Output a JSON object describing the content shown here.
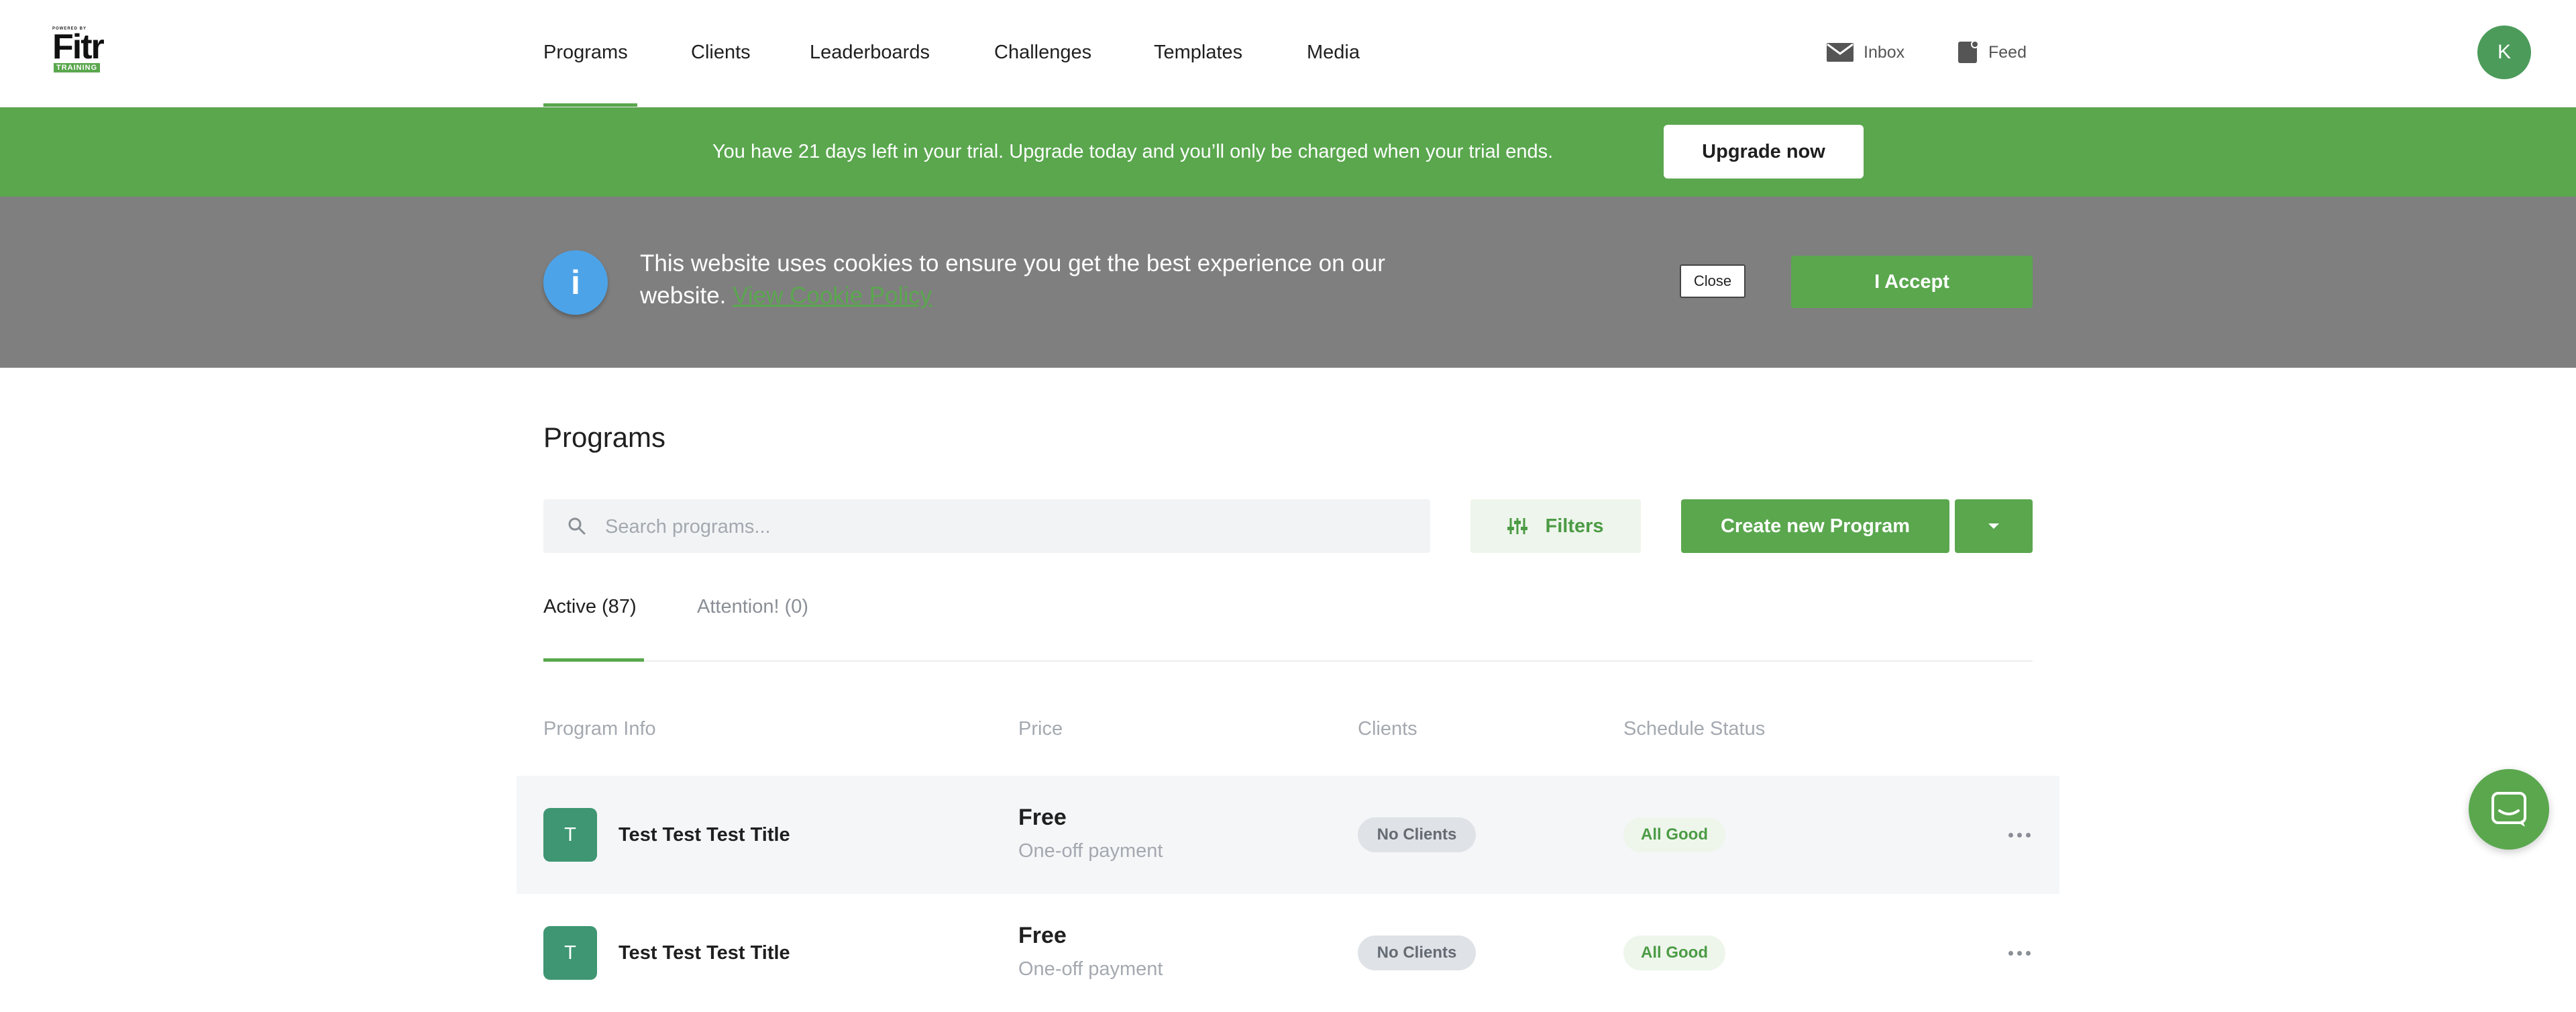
{
  "logo": {
    "small_text": "POWERED BY",
    "word": "Fitr",
    "tag": "TRAINING"
  },
  "nav": {
    "items": [
      "Programs",
      "Clients",
      "Leaderboards",
      "Challenges",
      "Templates",
      "Media"
    ],
    "active": "Programs",
    "inbox_label": "Inbox",
    "feed_label": "Feed",
    "avatar_initial": "K"
  },
  "trial_banner": {
    "text": "You have 21 days left in your trial. Upgrade today and you’ll only be charged when your trial ends.",
    "button_label": "Upgrade now"
  },
  "cookie_banner": {
    "text": "This website uses cookies to ensure you get the best experience on our website.",
    "link_label": "View Cookie Policy",
    "close_label": "Close",
    "accept_label": "I Accept"
  },
  "main": {
    "title": "Programs",
    "search_placeholder": "Search programs...",
    "filters_label": "Filters",
    "create_label": "Create new Program",
    "tabs": [
      {
        "label": "Active (87)",
        "active": true
      },
      {
        "label": "Attention! (0)",
        "active": false
      }
    ],
    "columns": [
      "Program Info",
      "Price",
      "Clients",
      "Schedule Status"
    ],
    "rows": [
      {
        "initial": "T",
        "title": "Test Test Test Title",
        "price": "Free",
        "price_sub": "One-off payment",
        "clients": "No Clients",
        "status": "All Good"
      },
      {
        "initial": "T",
        "title": "Test Test Test Title",
        "price": "Free",
        "price_sub": "One-off payment",
        "clients": "No Clients",
        "status": "All Good"
      }
    ]
  },
  "colors": {
    "brand_green": "#5aa74e",
    "cookie_gray": "#7f7f7f",
    "info_blue": "#4da3e8"
  }
}
